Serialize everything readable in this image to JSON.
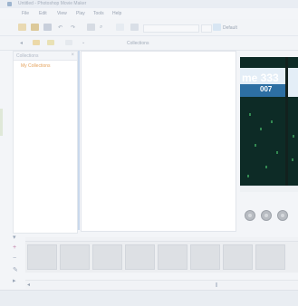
{
  "window": {
    "title": "Untitled - Photoshop Movie Maker"
  },
  "menu": [
    "File",
    "Edit",
    "View",
    "Play",
    "Tools",
    "Help"
  ],
  "toolbar": {
    "zoom_label": "Default",
    "path_label": "Collections"
  },
  "sidebar": {
    "header": "Collections",
    "item": "My Collections"
  },
  "preview": {
    "big_text": "me 333",
    "small_text": "007"
  },
  "colors": {
    "accent": "#2d6fa3",
    "timeline": "#dde0e4"
  },
  "icons": [
    "new-file-icon",
    "open-folder-icon",
    "save-icon",
    "undo-icon",
    "redo-icon",
    "print-icon",
    "search-icon",
    "close-icon",
    "play-icon",
    "stop-icon",
    "next-icon",
    "pencil-icon",
    "scroll-left-icon"
  ]
}
